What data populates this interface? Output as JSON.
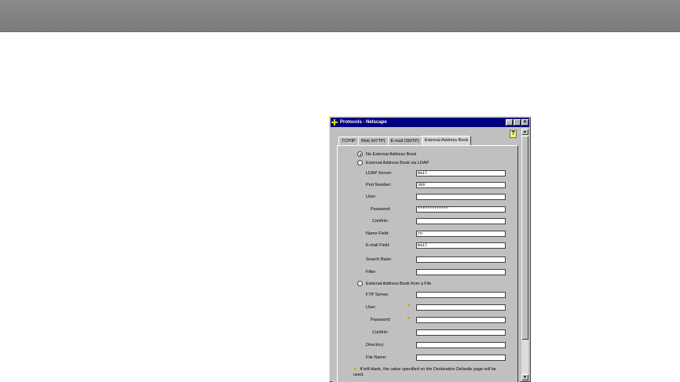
{
  "window": {
    "title": "Protocols - Netscape",
    "minimize": "_",
    "maximize": "□",
    "close": "✕",
    "help": "?"
  },
  "tabs": [
    {
      "label": "TCP/IP",
      "active": false
    },
    {
      "label": "Web (HTTP)",
      "active": false
    },
    {
      "label": "E-mail (SMTP)",
      "active": false
    },
    {
      "label": "External Address Book",
      "active": true
    }
  ],
  "options": {
    "none": "No External Address Book",
    "ldap": "External Address Book via LDAP",
    "file": "External Address Book from a File"
  },
  "ldap": {
    "server_label": "LDAP Server:",
    "server_value": "mail",
    "port_label": "Port Number:",
    "port_value": "389",
    "user_label": "User:",
    "user_value": "",
    "password_label": "Password:",
    "password_value": "*************",
    "confirm_label": "Confirm:",
    "confirm_value": "",
    "name_label": "Name Field:",
    "name_value": "cn",
    "email_label": "E-mail Field:",
    "email_value": "mail",
    "search_label": "Search Base:",
    "search_value": "",
    "filter_label": "Filter:",
    "filter_value": ""
  },
  "file": {
    "ftp_label": "FTP Server:",
    "ftp_value": "",
    "user_label": "User:",
    "user_value": "",
    "password_label": "Password:",
    "password_value": "",
    "confirm_label": "Confirm:",
    "confirm_value": "",
    "directory_label": "Directory:",
    "directory_value": "",
    "filename_label": "File Name:",
    "filename_value": ""
  },
  "note": "If left blank, the value specified on the Destination Defaults page will be used.",
  "icons": {
    "flag": "flag-icon"
  }
}
